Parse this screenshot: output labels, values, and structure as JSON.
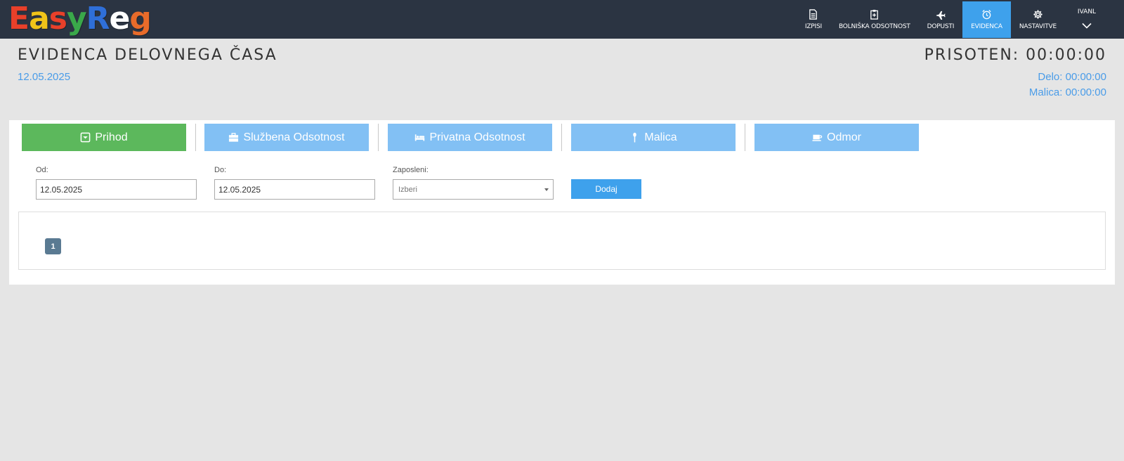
{
  "brand": {
    "logo_letters": [
      {
        "ch": "E",
        "color": "#e8402a"
      },
      {
        "ch": "a",
        "color": "#f0c419"
      },
      {
        "ch": "s",
        "color": "#e8402a"
      },
      {
        "ch": "y",
        "color": "#3aa84a"
      },
      {
        "ch": "R",
        "color": "#2f6fd8"
      },
      {
        "ch": "e",
        "color": "#ffffff"
      },
      {
        "ch": "g",
        "color": "#e86b2a"
      }
    ]
  },
  "nav": {
    "items": [
      {
        "label": "IZPISI",
        "icon": "document-icon"
      },
      {
        "label": "BOLNIŠKA ODSOTNOST",
        "icon": "clipboard-icon"
      },
      {
        "label": "DOPUSTI",
        "icon": "airplane-icon"
      },
      {
        "label": "EVIDENCA",
        "icon": "alarm-clock-icon"
      },
      {
        "label": "NASTAVITVE",
        "icon": "gear-icon"
      }
    ],
    "active": "EVIDENCA",
    "user": "IVANL"
  },
  "header": {
    "title": "EVIDENCA DELOVNEGA ČASA",
    "date": "12.05.2025",
    "presence": "PRISOTEN: 00:00:00",
    "delo": "Delo: 00:00:00",
    "malica": "Malica: 00:00:00"
  },
  "tabs": [
    {
      "label": "Prihod",
      "icon": "arrow-in-icon"
    },
    {
      "label": "Službena Odsotnost",
      "icon": "briefcase-icon"
    },
    {
      "label": "Privatna Odsotnost",
      "icon": "bed-icon"
    },
    {
      "label": "Malica",
      "icon": "spoon-icon"
    },
    {
      "label": "Odmor",
      "icon": "coffee-icon"
    }
  ],
  "form": {
    "od_label": "Od:",
    "od_value": "12.05.2025",
    "do_label": "Do:",
    "do_value": "12.05.2025",
    "zaposleni_label": "Zaposleni:",
    "zaposleni_placeholder": "Izberi",
    "add_button": "Dodaj"
  },
  "pagination": {
    "current": "1"
  },
  "colors": {
    "topbar": "#2b3442",
    "active_nav": "#3ea1ec",
    "green_tab": "#5cb85c",
    "blue_tab": "#82c0f4",
    "accent_text": "#4a9ce8"
  }
}
